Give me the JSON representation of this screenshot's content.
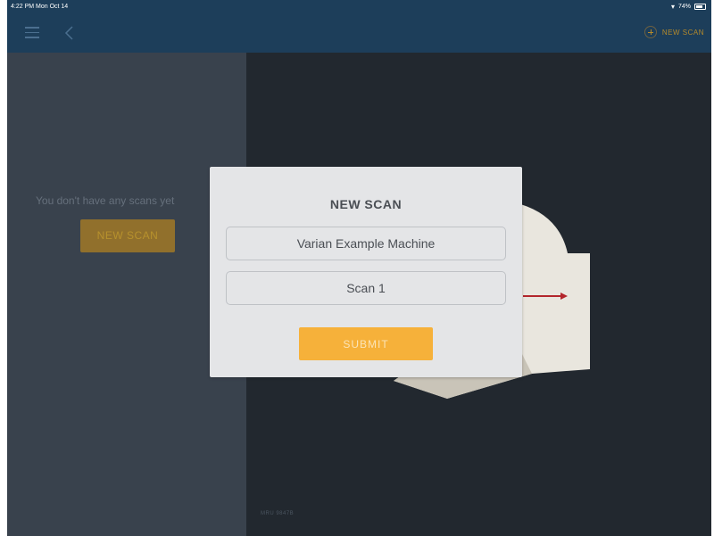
{
  "status_bar": {
    "time": "4:22 PM  Mon Oct 14",
    "battery": "74%"
  },
  "nav_bar": {
    "new_scan_label": "NEW SCAN"
  },
  "left_panel": {
    "empty_message": "You don't have any scans yet",
    "new_scan_label": "NEW SCAN"
  },
  "right_panel": {
    "footer": "MRU 9847B"
  },
  "modal": {
    "title": "NEW SCAN",
    "machine_value": "Varian Example Machine",
    "scan_name_value": "Scan 1",
    "submit_label": "SUBMIT"
  },
  "colors": {
    "nav_background": "#1d3e5a",
    "accent": "#f6b13a",
    "left_panel": "#39424d",
    "right_panel": "#22282f",
    "modal_background": "#e4e5e7"
  },
  "icons": {
    "menu": "hamburger-menu-icon",
    "back": "chevron-left-icon",
    "new_scan": "plus-circle-icon",
    "wifi": "wifi-icon",
    "battery": "battery-icon"
  }
}
